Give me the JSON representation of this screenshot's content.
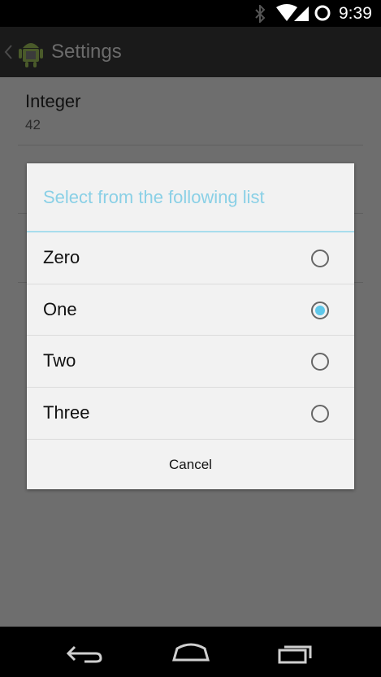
{
  "status_bar": {
    "time": "9:39",
    "icons": [
      "bluetooth-icon",
      "wifi-icon",
      "cellular-signal-icon",
      "battery-icon"
    ]
  },
  "action_bar": {
    "title": "Settings",
    "icons": [
      "up-caret-icon",
      "android-app-icon"
    ]
  },
  "preferences": {
    "integer": {
      "title": "Integer",
      "summary": "42"
    }
  },
  "dialog": {
    "title": "Select from the following list",
    "options": [
      {
        "label": "Zero",
        "selected": false
      },
      {
        "label": "One",
        "selected": true
      },
      {
        "label": "Two",
        "selected": false
      },
      {
        "label": "Three",
        "selected": false
      }
    ],
    "cancel_label": "Cancel"
  },
  "nav_bar": {
    "icons": [
      "back-icon",
      "home-icon",
      "recent-apps-icon"
    ]
  },
  "colors": {
    "accent": "#5fc8ea",
    "dialog_title": "#8ad0e6",
    "scrim": "#6e6e6e"
  }
}
